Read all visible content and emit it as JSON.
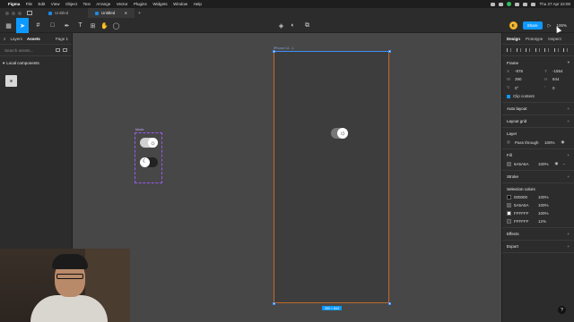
{
  "menubar": {
    "app": "Figma",
    "items": [
      "File",
      "Edit",
      "View",
      "Object",
      "Text",
      "Arrange",
      "Vector",
      "Plugins",
      "Widgets",
      "Window",
      "Help"
    ],
    "datetime": "Thu 27 Apr  22:00"
  },
  "tabs": [
    {
      "label": "Untitled",
      "active": false
    },
    {
      "label": "Untitled",
      "active": true
    }
  ],
  "toolbar": {
    "file_title": "Untitled",
    "avatar_letter": "E",
    "share_label": "Share",
    "zoom": "100%"
  },
  "left_panel": {
    "tabs": [
      "Layers",
      "Assets"
    ],
    "active_tab": "Assets",
    "page": "Page 1",
    "search_placeholder": "Search assets...",
    "section": "Local components"
  },
  "canvas": {
    "frame_label": "iPhone 14 - 1",
    "frame_size": "390 × 844",
    "mode_label": "Mode"
  },
  "right_panel": {
    "tabs": [
      "Design",
      "Prototype",
      "Inspect"
    ],
    "active_tab": "Design",
    "frame": {
      "title": "Frame",
      "x": "-976",
      "y": "-1554",
      "w": "390",
      "h": "844",
      "rotation": "0°",
      "radius": "0",
      "clip_content": "Clip content"
    },
    "auto_layout": "Auto layout",
    "layout_grid": "Layout grid",
    "layer": {
      "title": "Layer",
      "blend": "Pass through",
      "opacity": "100%"
    },
    "fill": {
      "title": "Fill",
      "hex": "5A5A5A",
      "opacity": "100%",
      "color": "#5A5A5A"
    },
    "stroke": "Stroke",
    "selection_colors": {
      "title": "Selection colors",
      "items": [
        {
          "hex": "000000",
          "opacity": "100%",
          "color": "#000000"
        },
        {
          "hex": "5A5A5A",
          "opacity": "100%",
          "color": "#5A5A5A"
        },
        {
          "hex": "FFFFFF",
          "opacity": "100%",
          "color": "#FFFFFF"
        },
        {
          "hex": "FFFFFF",
          "opacity": "12%",
          "color": "#FFFFFF"
        }
      ]
    },
    "effects": "Effects",
    "export": "Export"
  },
  "help": "?"
}
